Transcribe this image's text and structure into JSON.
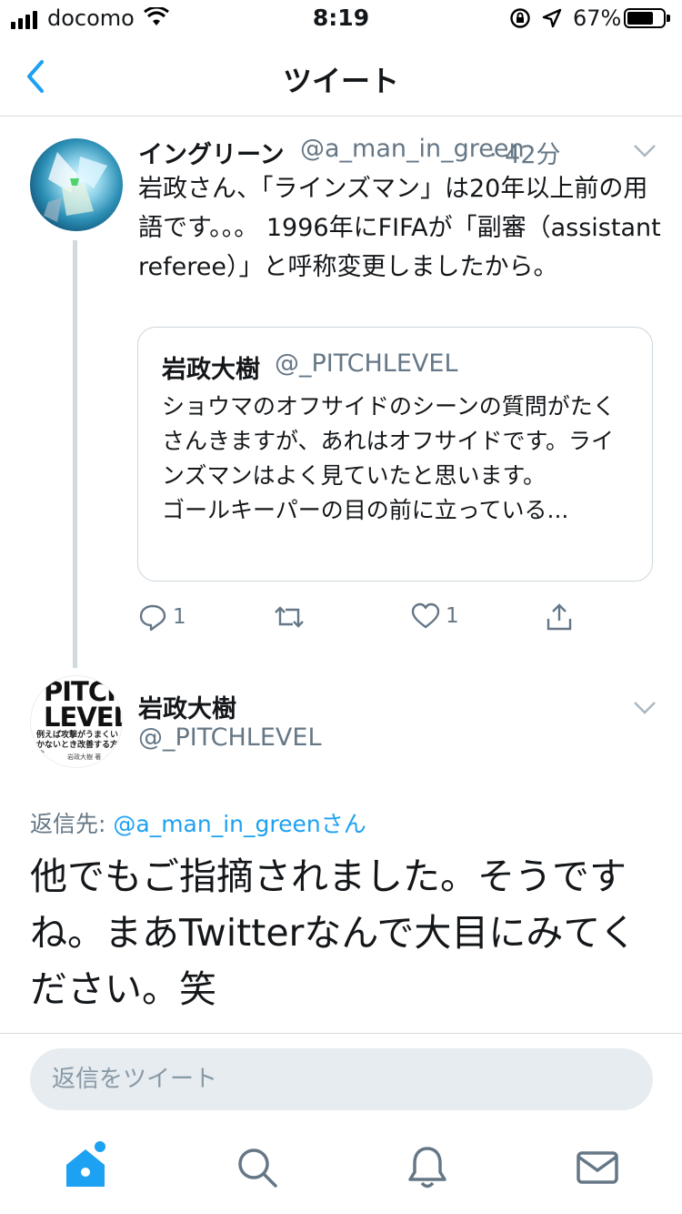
{
  "status_bar": {
    "carrier": "docomo",
    "time": "8:19",
    "battery": "67%"
  },
  "nav": {
    "title": "ツイート"
  },
  "parent_tweet": {
    "name": "イングリーン",
    "handle": "@a_man_in_green",
    "time": "· 42分",
    "text": "岩政さん、「ラインズマン」は20年以上前の用語です。。。 1996年にFIFAが「副審（assistant referee）」と呼称変更しましたから。",
    "quote": {
      "name": "岩政大樹",
      "handle": "@_PITCHLEVEL",
      "text": "ショウマのオフサイドのシーンの質問がたくさんきますが、あれはオフサイドです。ラインズマンはよく見ていたと思います。\nゴールキーパーの目の前に立っている..."
    },
    "reply_count": "1",
    "like_count": "1"
  },
  "main_tweet": {
    "name": "岩政大樹",
    "handle": "@_PITCHLEVEL",
    "avatar_text": {
      "line1": "PITCH",
      "line2": "LEVEL",
      "line3": "例えば攻撃がうまくいかないとき改善する方法",
      "line4": "岩政大樹 著"
    },
    "reply_prefix": "返信先: ",
    "reply_to": "@a_man_in_green",
    "reply_suffix": "さん",
    "text": "他でもご指摘されました。そうですね。まあTwitterなんで大目にみてください。笑"
  },
  "reply_input": {
    "placeholder": "返信をツイート"
  },
  "colors": {
    "accent": "#1da1f2",
    "secondary_text": "#657786",
    "border": "#ccd6dd"
  },
  "icons": [
    "back-chevron-icon",
    "chevron-down-icon",
    "reply-icon",
    "retweet-icon",
    "like-icon",
    "share-icon",
    "home-icon",
    "search-icon",
    "notifications-icon",
    "messages-icon"
  ]
}
